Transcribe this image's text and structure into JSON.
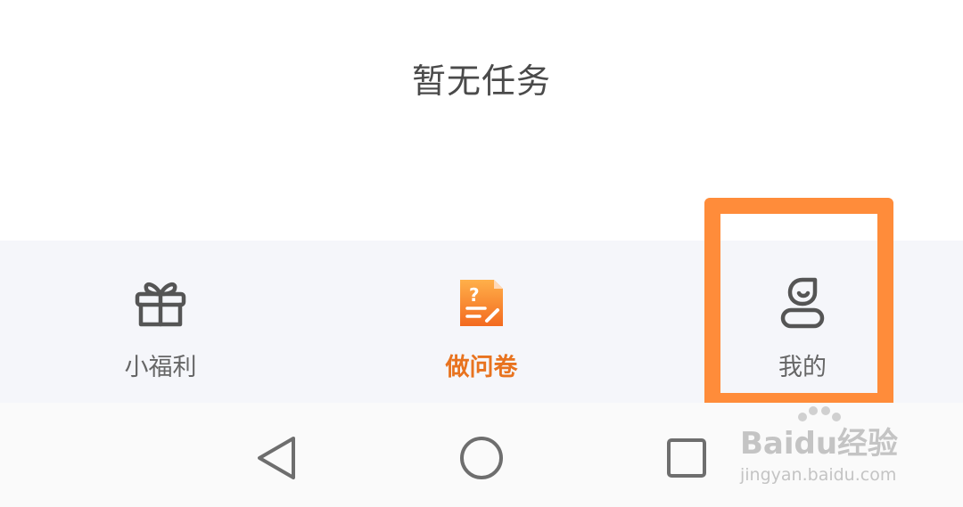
{
  "empty_state": {
    "message": "暂无任务"
  },
  "tabs": [
    {
      "label": "小福利",
      "icon": "gift-icon",
      "active": false
    },
    {
      "label": "做问卷",
      "icon": "survey-icon",
      "active": true
    },
    {
      "label": "我的",
      "icon": "profile-icon",
      "active": false
    }
  ],
  "system_nav": {
    "back": "back-icon",
    "home": "home-icon",
    "recents": "recents-icon"
  },
  "watermark": {
    "brand": "Baidu经验",
    "url": "jingyan.baidu.com"
  },
  "colors": {
    "accent": "#e8731f",
    "highlight": "#ff8c3a",
    "tabbar_bg": "#f5f6fa"
  }
}
